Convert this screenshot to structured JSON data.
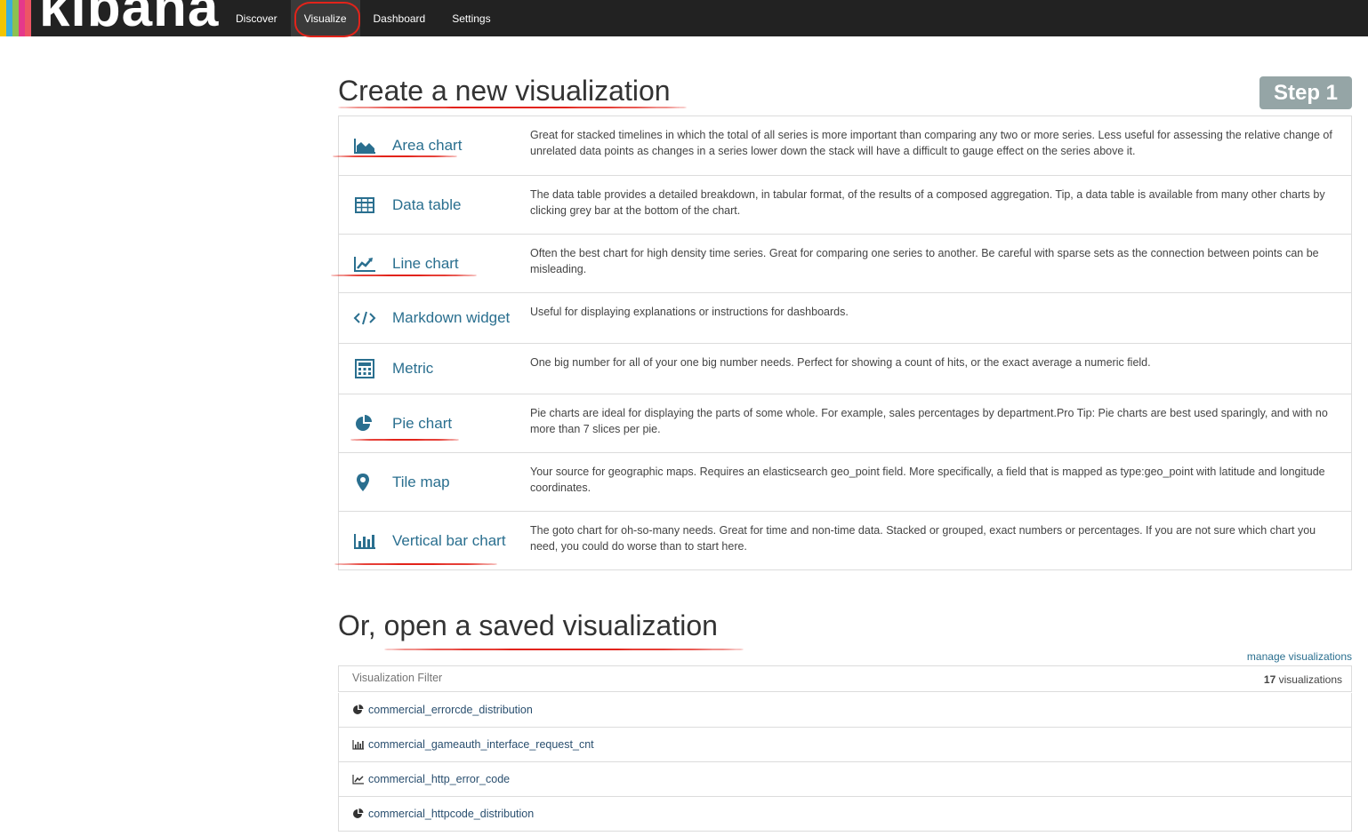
{
  "app": {
    "logo_text": "kibana",
    "logo_colors": [
      "#f2c500",
      "#3bafda",
      "#8cc152",
      "#e5388b",
      "#ed5565"
    ]
  },
  "nav": {
    "items": [
      {
        "label": "Discover"
      },
      {
        "label": "Visualize"
      },
      {
        "label": "Dashboard"
      },
      {
        "label": "Settings"
      }
    ],
    "active": "Visualize"
  },
  "create": {
    "title": "Create a new visualization",
    "step_label": "Step 1",
    "types": [
      {
        "name": "Area chart",
        "icon": "area-chart-icon",
        "description": "Great for stacked timelines in which the total of all series is more important than comparing any two or more series. Less useful for assessing the relative change of unrelated data points as changes in a series lower down the stack will have a difficult to gauge effect on the series above it."
      },
      {
        "name": "Data table",
        "icon": "table-icon",
        "description": "The data table provides a detailed breakdown, in tabular format, of the results of a composed aggregation. Tip, a data table is available from many other charts by clicking grey bar at the bottom of the chart."
      },
      {
        "name": "Line chart",
        "icon": "line-chart-icon",
        "description": "Often the best chart for high density time series. Great for comparing one series to another. Be careful with sparse sets as the connection between points can be misleading."
      },
      {
        "name": "Markdown widget",
        "icon": "code-icon",
        "description": "Useful for displaying explanations or instructions for dashboards."
      },
      {
        "name": "Metric",
        "icon": "calculator-icon",
        "description": "One big number for all of your one big number needs. Perfect for showing a count of hits, or the exact average a numeric field."
      },
      {
        "name": "Pie chart",
        "icon": "pie-chart-icon",
        "description": "Pie charts are ideal for displaying the parts of some whole. For example, sales percentages by department.Pro Tip: Pie charts are best used sparingly, and with no more than 7 slices per pie."
      },
      {
        "name": "Tile map",
        "icon": "map-marker-icon",
        "description": "Your source for geographic maps. Requires an elasticsearch geo_point field. More specifically, a field that is mapped as type:geo_point with latitude and longitude coordinates."
      },
      {
        "name": "Vertical bar chart",
        "icon": "bar-chart-icon",
        "description": "The goto chart for oh-so-many needs. Great for time and non-time data. Stacked or grouped, exact numbers or percentages. If you are not sure which chart you need, you could do worse than to start here."
      }
    ]
  },
  "saved": {
    "title": "Or, open a saved visualization",
    "manage_label": "manage visualizations",
    "filter_placeholder": "Visualization Filter",
    "count": "17",
    "count_suffix": "visualizations",
    "items": [
      {
        "name": "commercial_errorcde_distribution",
        "icon": "pie-chart-icon"
      },
      {
        "name": "commercial_gameauth_interface_request_cnt",
        "icon": "bar-chart-icon"
      },
      {
        "name": "commercial_http_error_code",
        "icon": "line-chart-icon"
      },
      {
        "name": "commercial_httpcode_distribution",
        "icon": "pie-chart-icon"
      }
    ]
  },
  "colors": {
    "accent": "#2a6f8f",
    "annotation_red": "#e2231a",
    "step_badge": "#95a5a6",
    "topbar": "#222222"
  }
}
